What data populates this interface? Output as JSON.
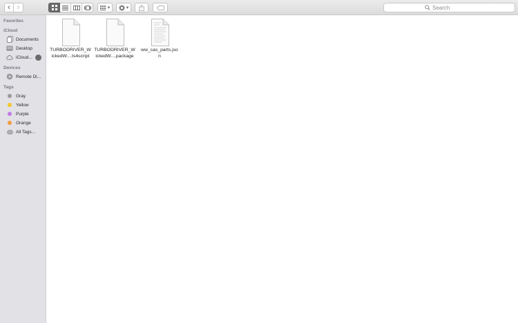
{
  "toolbar": {
    "back_glyph": "‹",
    "forward_glyph": "›",
    "view_modes": [
      "icon-view-icon",
      "list-view-icon",
      "column-view-icon",
      "gallery-view-icon"
    ],
    "active_view": "icon-view-icon",
    "group_by_caret": "▾",
    "action_caret": "▾",
    "search": {
      "placeholder": "Search"
    }
  },
  "sidebar": {
    "sections": {
      "favorites": "Favorites",
      "icloud": "iCloud",
      "devices": "Devices",
      "tags": "Tags"
    },
    "icloud_items": [
      {
        "label": "Documents",
        "icon": "documents-icon"
      },
      {
        "label": "Desktop",
        "icon": "desktop-icon"
      },
      {
        "label": "iCloud...",
        "icon": "cloud-icon"
      }
    ],
    "device_items": [
      {
        "label": "Remote Di...",
        "icon": "disc-icon"
      }
    ],
    "tag_items": [
      {
        "label": "Gray",
        "color": "#9a9a9a"
      },
      {
        "label": "Yellow",
        "color": "#f5c62c"
      },
      {
        "label": "Purple",
        "color": "#c27be2"
      },
      {
        "label": "Orange",
        "color": "#f39a3c"
      },
      {
        "label": "All Tags...",
        "icon": "all-tags-icon"
      }
    ]
  },
  "files": [
    {
      "name": "TURBODRIVER_W\nickedW....ts4script",
      "icon": "blank-document-icon"
    },
    {
      "name": "TURBODRIVER_W\nickedW....package",
      "icon": "blank-document-icon"
    },
    {
      "name": "ww_cas_parts.jso\nn",
      "icon": "text-document-icon"
    }
  ]
}
